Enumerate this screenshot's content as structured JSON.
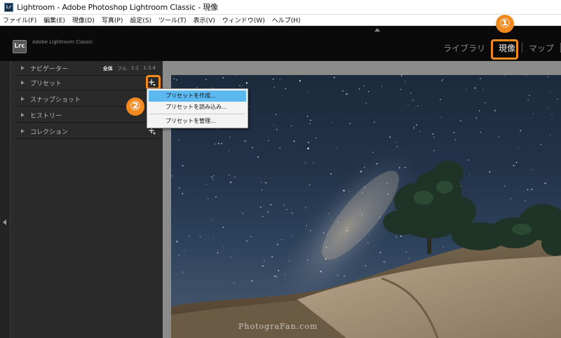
{
  "titlebar": {
    "icon": "Lr",
    "title": "Lightroom - Adobe Photoshop Lightroom Classic - 現像"
  },
  "menubar": [
    "ファイル(F)",
    "編集(E)",
    "現像(D)",
    "写真(P)",
    "設定(S)",
    "ツール(T)",
    "表示(V)",
    "ウィンドウ(W)",
    "ヘルプ(H)"
  ],
  "header": {
    "logo": "Lrc",
    "product": "Adobe Lightroom Classic",
    "modules": [
      "ライブラリ",
      "現像",
      "マップ"
    ],
    "active_module": "現像"
  },
  "annotations": {
    "badge1": "①",
    "badge2": "②",
    "highlight_color": "#f28a1e"
  },
  "left_panel": {
    "navigator": {
      "label": "ナビゲーター",
      "options": [
        "全体",
        "フル",
        "1:1",
        "1:3.4"
      ],
      "selected": "全体"
    },
    "sections": [
      {
        "label": "プリセット",
        "has_add": true
      },
      {
        "label": "スナップショット",
        "has_add": false
      },
      {
        "label": "ヒストリー",
        "has_add": false
      },
      {
        "label": "コレクション",
        "has_add": true
      }
    ],
    "add_icon": "+"
  },
  "preset_menu": {
    "items": [
      "プリセットを作成...",
      "プリセットを読み込み...",
      "プリセットを管理..."
    ],
    "highlighted": "プリセットを作成..."
  },
  "photo": {
    "description_icon": "milky-way-photo",
    "watermark": "PhotograFan.com"
  }
}
